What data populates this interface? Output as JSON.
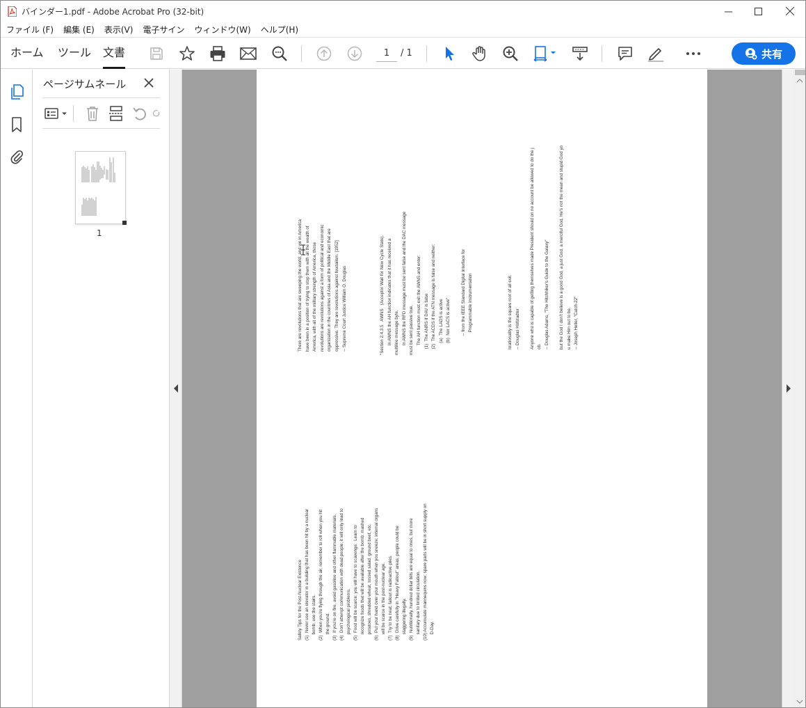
{
  "window": {
    "title": "バインダー1.pdf - Adobe Acrobat Pro (32-bit)"
  },
  "menu": [
    "ファイル (F)",
    "編集 (E)",
    "表示(V)",
    "電子サイン",
    "ウィンドウ(W)",
    "ヘルプ(H)"
  ],
  "tabs": [
    "ホーム",
    "ツール",
    "文書"
  ],
  "toolbar": {
    "page_current": "1",
    "page_total": "/ 1",
    "share_label": "共有",
    "accent": "#1473e6"
  },
  "panel": {
    "title": "ページサムネール",
    "thumb_label": "1"
  },
  "document": {
    "col1": [
      "There are revolutions that are sweeping the world, and we in America",
      "have been in a position of trying to stop them with all the wealth of",
      "America, with all of the military strength of America, those",
      "revolutions are revolutions against a form of political and economic",
      "organization in the countries of Asia and the Middle East that are",
      "oppressive. They are revolutions against feudalism. [1952]",
      "-- Supreme Court Justice William O. Douglas"
    ],
    "col2": [
      "\"Section 2.4.3.5   AWNS   (Acceptor Wait for New Cycle State).",
      "        In AWNS the AH function indicates that it has received a",
      "multiline message byte.",
      "        In AWNS the RFD message must be sent false and the DAC message",
      "must be sent passive true.",
      "        The AH function must exit the AWNS and enter:",
      "     (1)  The ANRS if DAV is false",
      "     (2)  The ACDS if the ATN message is false and neither:",
      "          (a)  The LADS is active",
      "          (b)  Nor LACS is active\"",
      "",
      "                -- from the IEEE Standard Digital Interface for",
      "                   Programmable Instrumentation"
    ],
    "col3": [
      "Irrationality is the square root of all evil.",
      "-- Douglas Hofstadter",
      "",
      "Anyone who is capable of getting themselves made President should on no account be allowed to do the j",
      "ob.",
      "-- Douglas Adams, \"The Hitchhiker's Guide to the Galaxy\"",
      "",
      "but the God I don't believe is a good God, a just God, a merciful God. He's not the mean and stupid God yo",
      "u make Him out to be.",
      "-- Joseph Heller, \"Catch-22\""
    ],
    "col4": [
      "Safety Tips for the Post-Nuclear Existence",
      "(1)  Never use an elevator in a building that has been hit by a nuclear",
      "     bomb; use the stairs.",
      "(2)  When you're flying through the air, remember to roll when you hit",
      "     the ground.",
      "(3)  If you're on fire, avoid gasoline and other flammable materials.",
      "(4)  Don't attempt communication with dead people; it will only lead to",
      "     psychological problems.",
      "(5)  Food will be scarce; you will have to scavenge.  Learn to",
      "     recognize foods that will be available after the bomb: mashed",
      "     potatoes, shredded wheat, tossed salad, ground beef, etc.",
      "(6)  Put your hand over your mouth when you sneeze; internal organs",
      "     will be scarce in the post-nuclear age.",
      "(7)  Try to be neat; fallout is radioactive piles.",
      "(8)  Drive carefully in \"Heavy Fallout\" areas; people could be",
      "     staggering illegally.",
      "(9)  Nutritionally, hundred dollar bills are equal to ones, but more",
      "     sanitary due to limited circulation.",
      "(10) Accumulate mannequins now; spare parts will be in short supply on",
      "     D-Day."
    ]
  }
}
